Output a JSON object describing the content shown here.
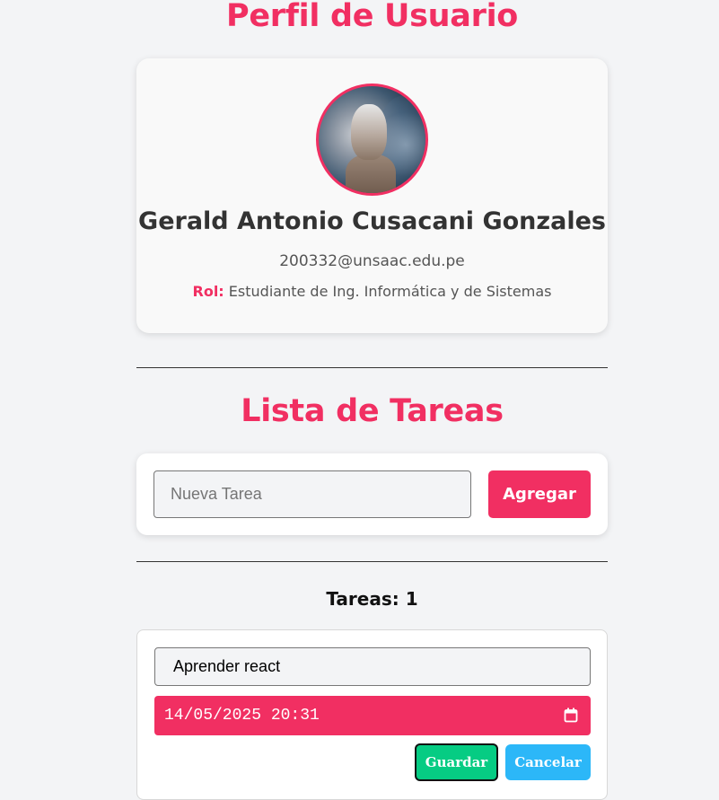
{
  "profile": {
    "title": "Perfil de Usuario",
    "name": "Gerald Antonio Cusacani Gonzales",
    "email": "200332@unsaac.edu.pe",
    "role_label": "Rol:",
    "role_value": "Estudiante de Ing. Informática y de Sistemas"
  },
  "tasks": {
    "title": "Lista de Tareas",
    "new_task_placeholder": "Nueva Tarea",
    "add_button": "Agregar",
    "count_text": "Tareas: 1",
    "items": [
      {
        "text": "Aprender react",
        "datetime": "14/05/2025 20:31",
        "save_button": "Guardar",
        "cancel_button": "Cancelar"
      }
    ]
  },
  "colors": {
    "accent": "#f12f62",
    "save": "#06cc83",
    "cancel": "#2cb7f8",
    "background": "#f3f4f6"
  },
  "icons": {
    "calendar": "calendar-icon"
  }
}
